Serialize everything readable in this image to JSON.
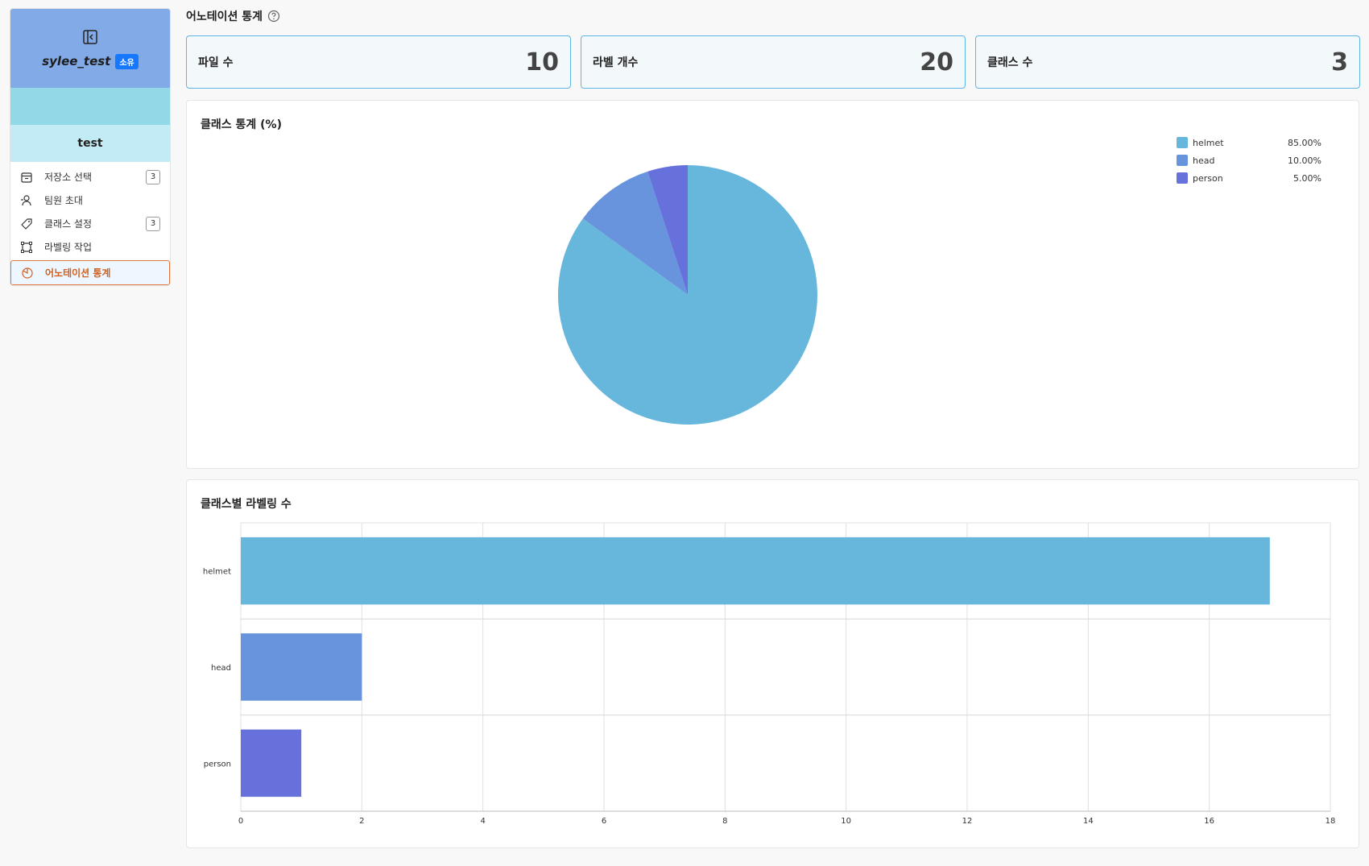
{
  "sidebar": {
    "workspace_name": "sylee_test",
    "workspace_badge": "소유",
    "project_name": "test",
    "items": [
      {
        "label": "저장소 선택",
        "count": "3",
        "icon": "storage-icon"
      },
      {
        "label": "팀원 초대",
        "count": "",
        "icon": "user-add-icon"
      },
      {
        "label": "클래스 설정",
        "count": "3",
        "icon": "tag-icon"
      },
      {
        "label": "라벨링 작업",
        "count": "",
        "icon": "bbox-icon"
      },
      {
        "label": "어노테이션 통계",
        "count": "",
        "icon": "pie-icon"
      }
    ]
  },
  "page": {
    "title": "어노테이션 통계"
  },
  "stats": [
    {
      "label": "파일 수",
      "value": "10"
    },
    {
      "label": "라벨 개수",
      "value": "20"
    },
    {
      "label": "클래스 수",
      "value": "3"
    }
  ],
  "pie_card": {
    "title": "클래스 통계 (%)"
  },
  "bar_card": {
    "title": "클래스별 라벨링 수"
  },
  "colors": {
    "helmet": "#67b7dc",
    "head": "#6794dc",
    "person": "#6771dc"
  },
  "chart_data": [
    {
      "type": "pie",
      "title": "클래스 통계 (%)",
      "categories": [
        "helmet",
        "head",
        "person"
      ],
      "values": [
        85.0,
        10.0,
        5.0
      ],
      "value_labels": [
        "85.00%",
        "10.00%",
        "5.00%"
      ],
      "legend": "top-right"
    },
    {
      "type": "bar",
      "orientation": "horizontal",
      "title": "클래스별 라벨링 수",
      "categories": [
        "helmet",
        "head",
        "person"
      ],
      "values": [
        17,
        2,
        1
      ],
      "xlim": [
        0,
        18
      ],
      "xticks": [
        0,
        2,
        4,
        6,
        8,
        10,
        12,
        14,
        16,
        18
      ],
      "grid": true
    }
  ]
}
